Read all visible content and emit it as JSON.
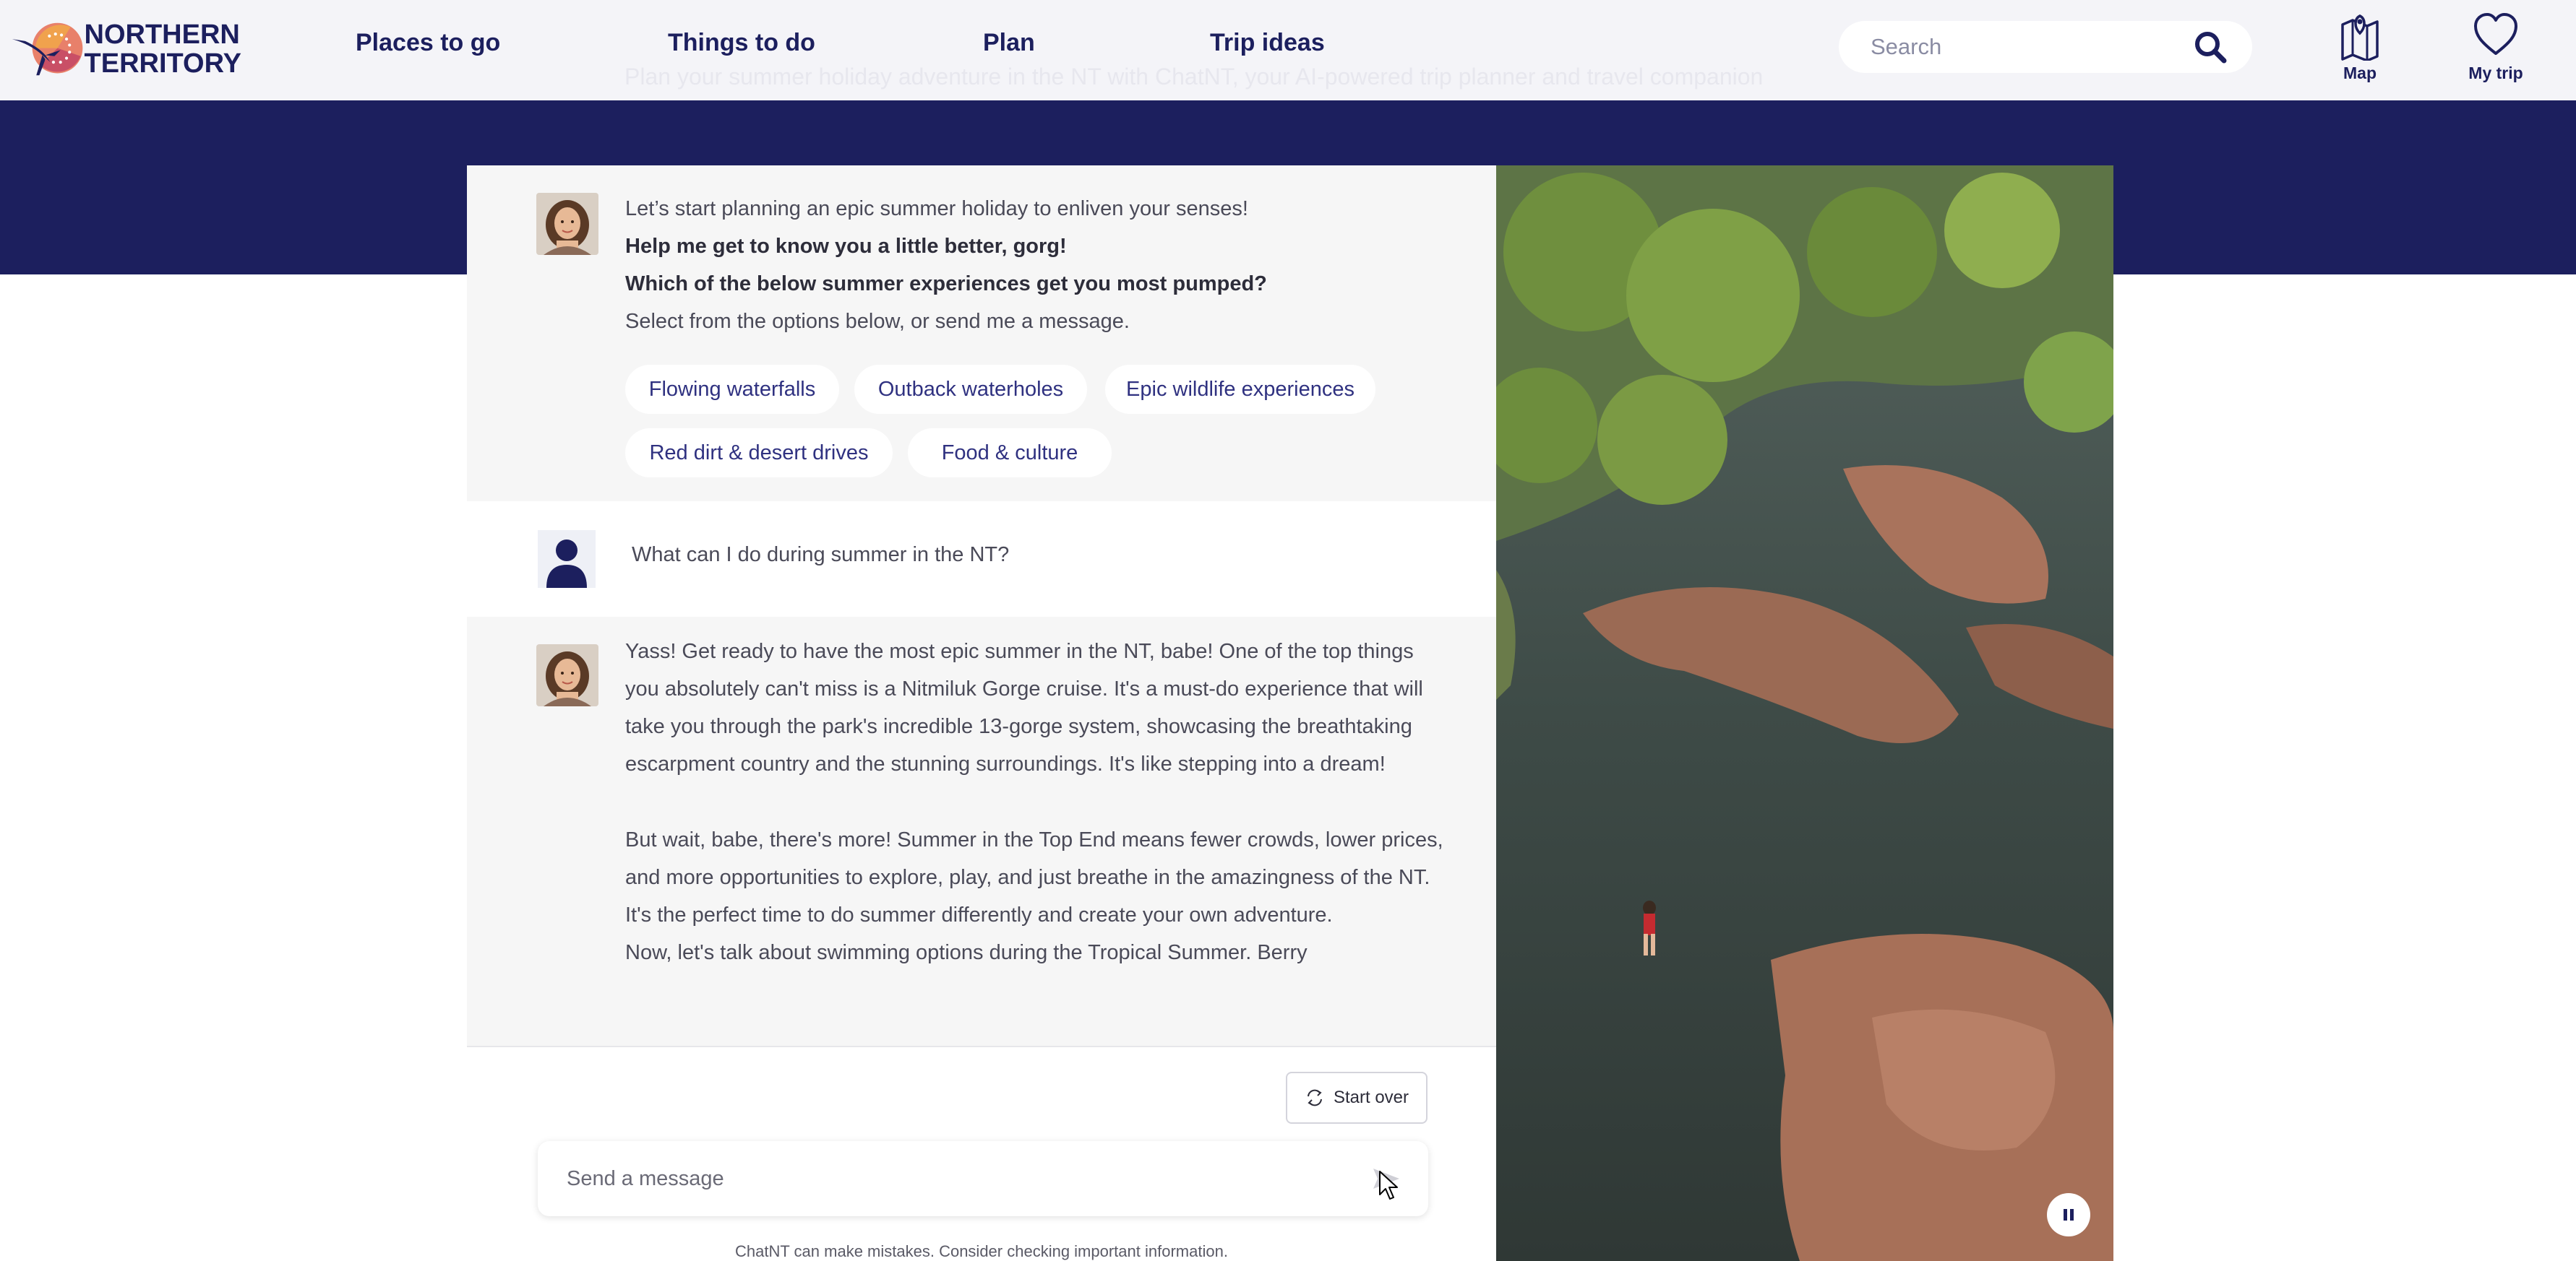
{
  "header": {
    "logo_line1": "NORTHERN",
    "logo_line2": "TERRITORY",
    "nav": [
      {
        "label": "Places to go"
      },
      {
        "label": "Things to do"
      },
      {
        "label": "Plan"
      },
      {
        "label": "Trip ideas"
      }
    ],
    "search": {
      "placeholder": "Search",
      "icon": "search-icon"
    },
    "tools": [
      {
        "label": "Map",
        "icon": "map-pin-icon"
      },
      {
        "label": "My trip",
        "icon": "heart-icon"
      }
    ],
    "faded_background_text": "Plan your summer holiday adventure in the NT with ChatNT, your AI-powered trip planner and travel companion"
  },
  "chat": {
    "intro": {
      "line1": "Let’s start planning an epic summer holiday to enliven your senses!",
      "line2": "Help me get to know you a little better, gorg!",
      "line3": "Which of the below summer experiences get you most pumped?",
      "line4": "Select from the options below, or send me a message."
    },
    "chips": [
      {
        "label": "Flowing waterfalls"
      },
      {
        "label": "Outback waterholes"
      },
      {
        "label": "Epic wildlife experiences"
      },
      {
        "label": "Red dirt & desert drives"
      },
      {
        "label": "Food & culture"
      }
    ],
    "user_message": "What can I do during summer in the NT?",
    "reply": {
      "p1": "Yass! Get ready to have the most epic summer in the NT, babe! One of the top things you absolutely can't miss is a Nitmiluk Gorge cruise. It's a must-do experience that will take you through the park's incredible 13-gorge system, showcasing the breathtaking escarpment country and the stunning surroundings. It's like stepping into a dream!",
      "p2": "But wait, babe, there's more! Summer in the Top End means fewer crowds, lower prices, and more opportunities to explore, play, and just breathe in the amazingness of the NT. It's the perfect time to do summer differently and create your own adventure.",
      "p3": "Now, let's talk about swimming options during the Tropical Summer. Berry"
    },
    "start_over_label": "Start over",
    "input_placeholder": "Send a message",
    "disclaimer": "ChatNT can make mistakes. Consider checking important information."
  },
  "colors": {
    "brand_navy": "#1c1f5e",
    "chip_text": "#2f3180",
    "panel_bg": "#f6f6f6"
  }
}
